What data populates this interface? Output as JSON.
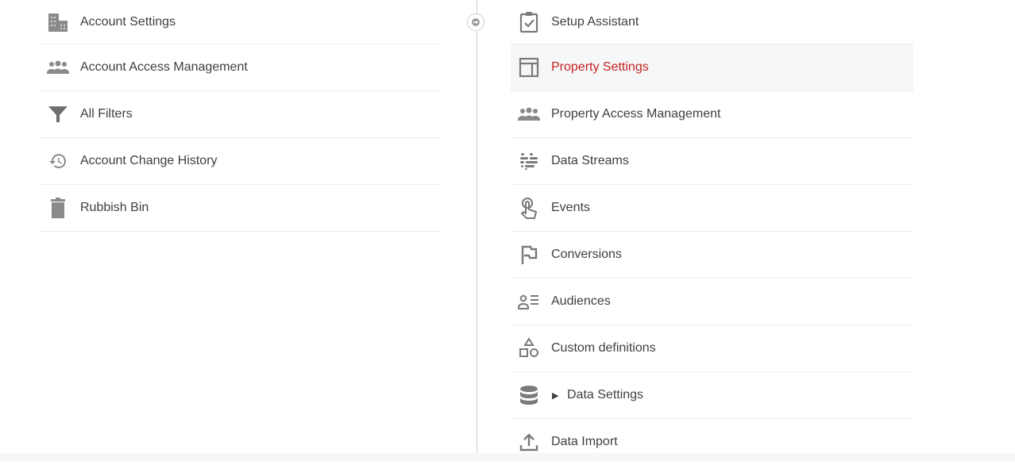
{
  "account_column": {
    "items": [
      {
        "label": "Account Settings",
        "icon": "building-icon"
      },
      {
        "label": "Account Access Management",
        "icon": "people-icon"
      },
      {
        "label": "All Filters",
        "icon": "filter-icon"
      },
      {
        "label": "Account Change History",
        "icon": "history-icon"
      },
      {
        "label": "Rubbish Bin",
        "icon": "trash-icon"
      }
    ]
  },
  "property_column": {
    "active_item": "Property Settings",
    "active_color": "#c5221f",
    "items": [
      {
        "label": "Setup Assistant",
        "icon": "clipboard-check-icon"
      },
      {
        "label": "Property Settings",
        "icon": "layout-icon"
      },
      {
        "label": "Property Access Management",
        "icon": "people-icon"
      },
      {
        "label": "Data Streams",
        "icon": "data-streams-icon"
      },
      {
        "label": "Events",
        "icon": "touch-icon"
      },
      {
        "label": "Conversions",
        "icon": "flag-icon"
      },
      {
        "label": "Audiences",
        "icon": "audience-icon"
      },
      {
        "label": "Custom definitions",
        "icon": "shapes-icon"
      },
      {
        "label": "Data Settings",
        "icon": "database-icon",
        "expandable": true
      },
      {
        "label": "Data Import",
        "icon": "upload-icon"
      }
    ]
  },
  "column_toggle": {
    "icon": "arrow-right-icon"
  }
}
